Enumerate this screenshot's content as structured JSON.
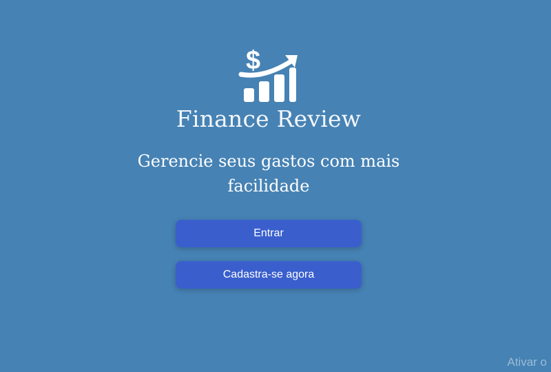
{
  "brand": {
    "name": "Finance Review",
    "logo_icon": "dollar-growth-chart-icon"
  },
  "hero": {
    "tagline": "Gerencie seus gastos com mais facilidade"
  },
  "actions": {
    "login_label": "Entrar",
    "signup_label": "Cadastra-se agora"
  },
  "system": {
    "watermark_text": "Ativar o"
  },
  "colors": {
    "background": "#4682b4",
    "button": "#3a5fcd",
    "text": "#ffffff"
  }
}
